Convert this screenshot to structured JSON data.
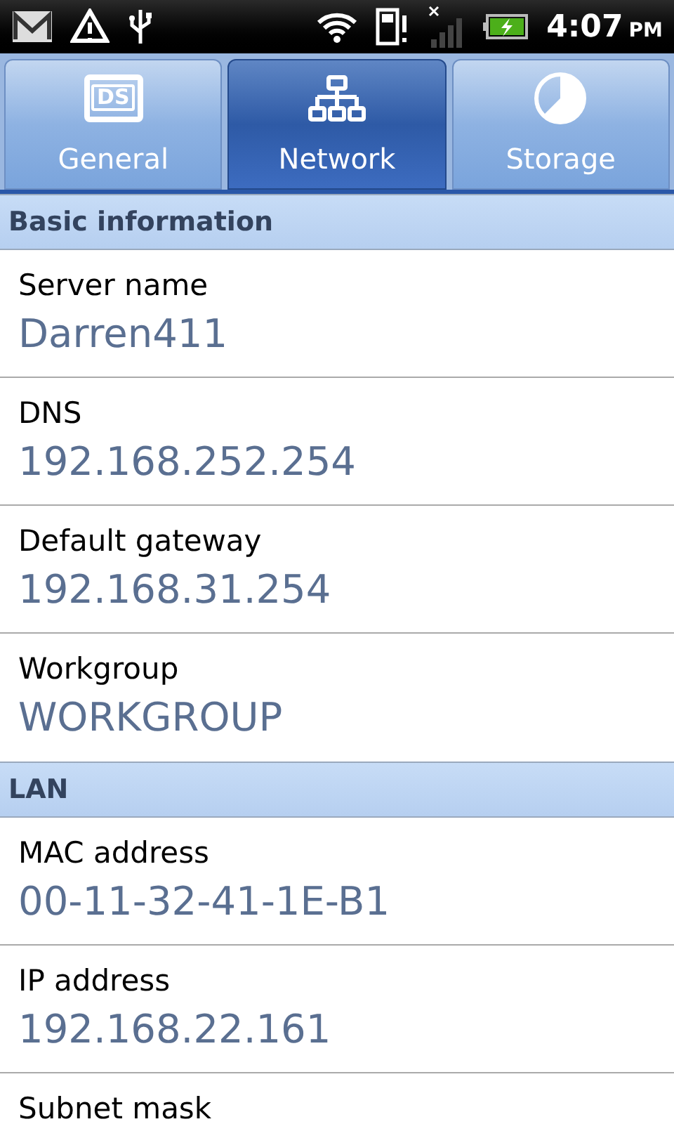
{
  "status_bar": {
    "time": "4:07",
    "ampm": "PM"
  },
  "tabs": [
    {
      "label": "General",
      "kind": "ds",
      "icon_text": "DS",
      "selected": false
    },
    {
      "label": "Network",
      "kind": "network",
      "selected": true
    },
    {
      "label": "Storage",
      "kind": "pie",
      "selected": false
    }
  ],
  "sections": [
    {
      "title": "Basic information",
      "rows": [
        {
          "label": "Server name",
          "value": "Darren411"
        },
        {
          "label": "DNS",
          "value": "192.168.252.254"
        },
        {
          "label": "Default gateway",
          "value": "192.168.31.254"
        },
        {
          "label": "Workgroup",
          "value": "WORKGROUP"
        }
      ]
    },
    {
      "title": "LAN",
      "rows": [
        {
          "label": "MAC address",
          "value": "00-11-32-41-1E-B1"
        },
        {
          "label": "IP address",
          "value": "192.168.22.161"
        },
        {
          "label": "Subnet mask"
        }
      ]
    }
  ]
}
